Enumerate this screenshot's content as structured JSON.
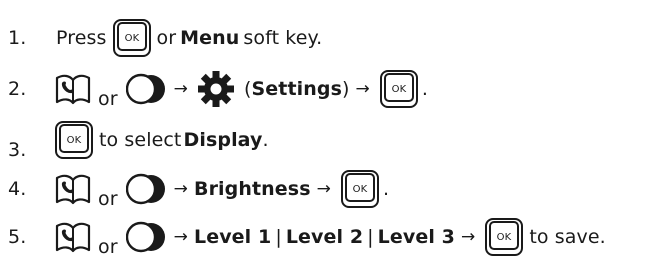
{
  "ok_key_label": "OK",
  "steps": [
    {
      "number": "1.",
      "press": "Press",
      "or": "or",
      "menu": "Menu",
      "soft_key": "soft key."
    },
    {
      "number": "2.",
      "or": "or",
      "arrow1": "→",
      "paren_open": "(",
      "settings": "Settings",
      "paren_close": ")",
      "arrow2": "→",
      "end": "."
    },
    {
      "number": "3.",
      "to_select": "to select",
      "display": "Display",
      "end": "."
    },
    {
      "number": "4.",
      "or": "or",
      "arrow1": "→",
      "brightness": "Brightness",
      "arrow2": "→",
      "end": "."
    },
    {
      "number": "5.",
      "or": "or",
      "arrow1": "→",
      "level1": "Level 1",
      "bar1": "|",
      "level2": "Level 2",
      "bar2": "|",
      "level3": "Level 3",
      "arrow2": "→",
      "to_save": "to save."
    }
  ],
  "icons": {
    "ok_key": "ok-key-icon",
    "phonebook": "phonebook-icon",
    "nav_key": "nav-key-icon",
    "settings": "gear-icon"
  }
}
